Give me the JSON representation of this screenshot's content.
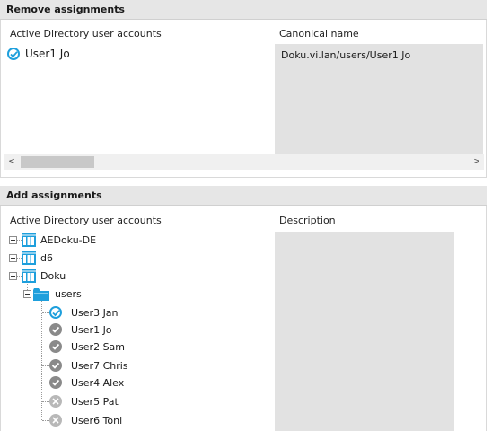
{
  "remove": {
    "title": "Remove assignments",
    "col1": "Active Directory user accounts",
    "col2": "Canonical name",
    "rows": [
      {
        "name": "User1 Jo",
        "canonical": "Doku.vi.lan/users/User1 Jo",
        "status_icon": "check-circle-blue-icon"
      }
    ],
    "scroll_left": "<",
    "scroll_right": ">"
  },
  "add": {
    "title": "Add assignments",
    "col1": "Active Directory user accounts",
    "col2": "Description",
    "domains": [
      {
        "label": "AEDoku-DE",
        "expanded": false,
        "icon": "domain-icon"
      },
      {
        "label": "d6",
        "expanded": false,
        "icon": "domain-icon"
      },
      {
        "label": "Doku",
        "expanded": true,
        "icon": "domain-icon"
      }
    ],
    "folder": {
      "label": "users",
      "expanded": true,
      "icon": "folder-icon"
    },
    "users": [
      {
        "label": "User3 Jan",
        "state": "selected"
      },
      {
        "label": "User1 Jo",
        "state": "assigned"
      },
      {
        "label": "User2 Sam",
        "state": "assigned"
      },
      {
        "label": "User7 Chris",
        "state": "assigned"
      },
      {
        "label": "User4 Alex",
        "state": "assigned"
      },
      {
        "label": "User5 Pat",
        "state": "unavailable"
      },
      {
        "label": "User6 Toni",
        "state": "unavailable"
      }
    ]
  },
  "colors": {
    "accent": "#1e9fdc",
    "header_bg": "#e6e6e6",
    "column_bg": "#e2e2e2",
    "assigned_grey": "#8a8a8a",
    "unavailable_grey": "#b8b8b8"
  }
}
